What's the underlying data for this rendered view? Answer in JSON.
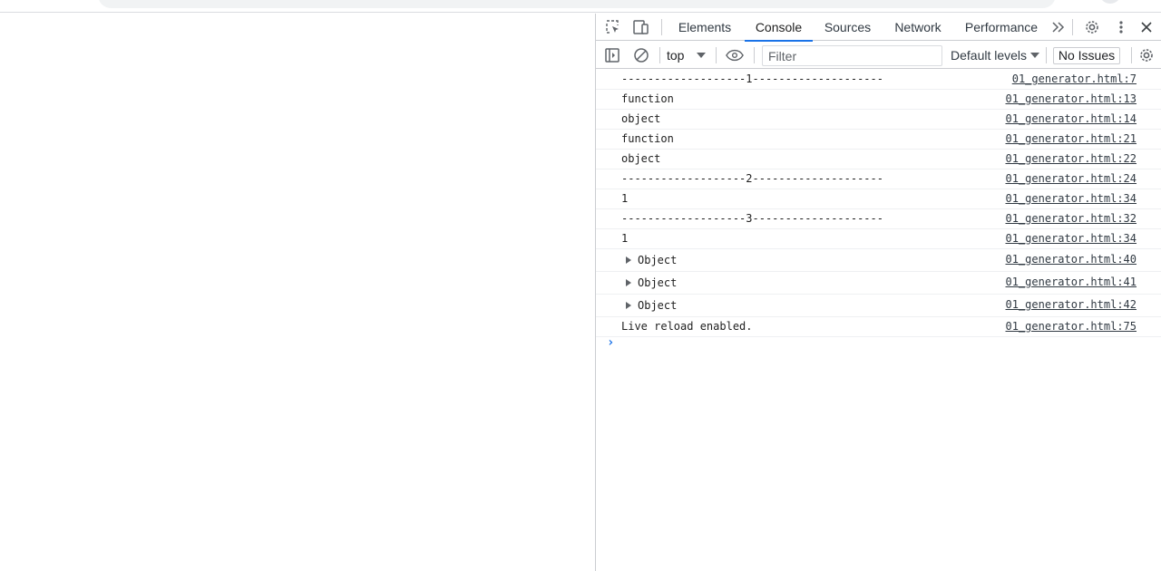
{
  "browser": {},
  "devtools": {
    "icons": {
      "inspect": "inspect-element-icon",
      "device": "device-toolbar-icon",
      "more_tabs": "chevron-double-right-icon",
      "settings": "gear-icon",
      "kebab": "kebab-menu-icon",
      "close": "close-icon"
    },
    "tabs": [
      {
        "label": "Elements"
      },
      {
        "label": "Console"
      },
      {
        "label": "Sources"
      },
      {
        "label": "Network"
      },
      {
        "label": "Performance"
      }
    ],
    "active_tab": "Console",
    "accent_color": "#1a73e8",
    "toolbar": {
      "context": "top",
      "filter_placeholder": "Filter",
      "filter_value": "",
      "levels": "Default levels",
      "issues": "No Issues"
    },
    "messages": [
      {
        "text": "-------------------1--------------------",
        "source": "01_generator.html:7"
      },
      {
        "text": "function",
        "source": "01_generator.html:13"
      },
      {
        "text": "object",
        "source": "01_generator.html:14"
      },
      {
        "text": "function",
        "source": "01_generator.html:21"
      },
      {
        "text": "object",
        "source": "01_generator.html:22"
      },
      {
        "text": "-------------------2--------------------",
        "source": "01_generator.html:24"
      },
      {
        "text": "1",
        "source": "01_generator.html:34"
      },
      {
        "text": "-------------------3--------------------",
        "source": "01_generator.html:32"
      },
      {
        "text": "1",
        "source": "01_generator.html:34"
      },
      {
        "text": "Object",
        "source": "01_generator.html:40",
        "expandable": true
      },
      {
        "text": "Object",
        "source": "01_generator.html:41",
        "expandable": true
      },
      {
        "text": "Object",
        "source": "01_generator.html:42",
        "expandable": true
      },
      {
        "text": "Live reload enabled.",
        "source": "01_generator.html:75"
      }
    ],
    "prompt_symbol": "›"
  }
}
